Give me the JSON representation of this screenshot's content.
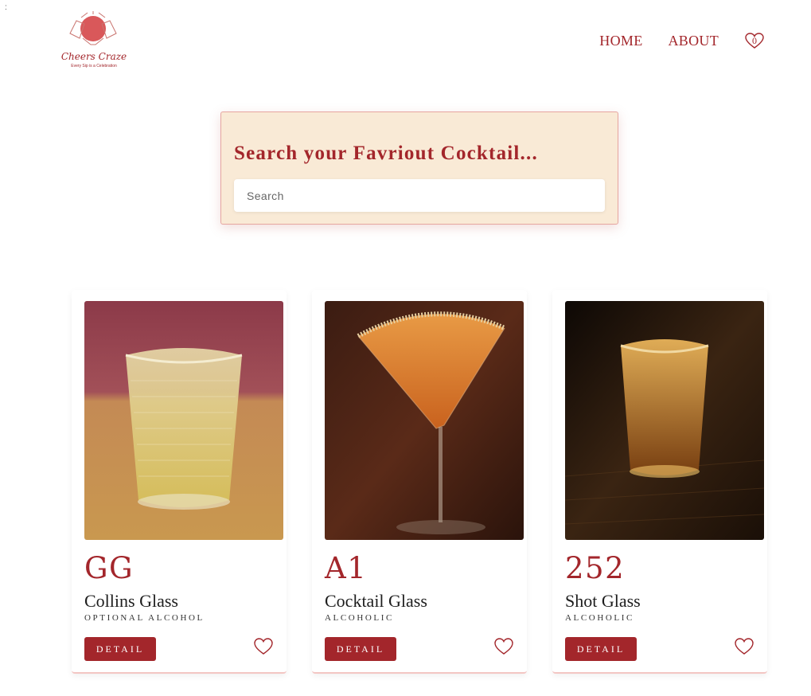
{
  "corner_mark": ":",
  "logo": {
    "name": "Cheers Craze",
    "tagline": "Every Sip is a Celebration"
  },
  "nav": {
    "home": "HOME",
    "about": "ABOUT",
    "favorites_count": "0"
  },
  "search": {
    "title": "Search your Favriout Cocktail...",
    "placeholder": "Search",
    "value": ""
  },
  "cards": [
    {
      "id": "GG",
      "glass": "Collins Glass",
      "type": "OPTIONAL ALCOHOL",
      "button": "DETAIL"
    },
    {
      "id": "A1",
      "glass": "Cocktail Glass",
      "type": "ALCOHOLIC",
      "button": "DETAIL"
    },
    {
      "id": "252",
      "glass": "Shot Glass",
      "type": "ALCOHOLIC",
      "button": "DETAIL"
    }
  ],
  "colors": {
    "accent": "#a3262b",
    "panel_bg": "#f9ead6",
    "panel_border": "#e6a5a0"
  },
  "icons": {
    "favorites": "heart-icon",
    "card_favorite": "heart-outline-icon"
  }
}
